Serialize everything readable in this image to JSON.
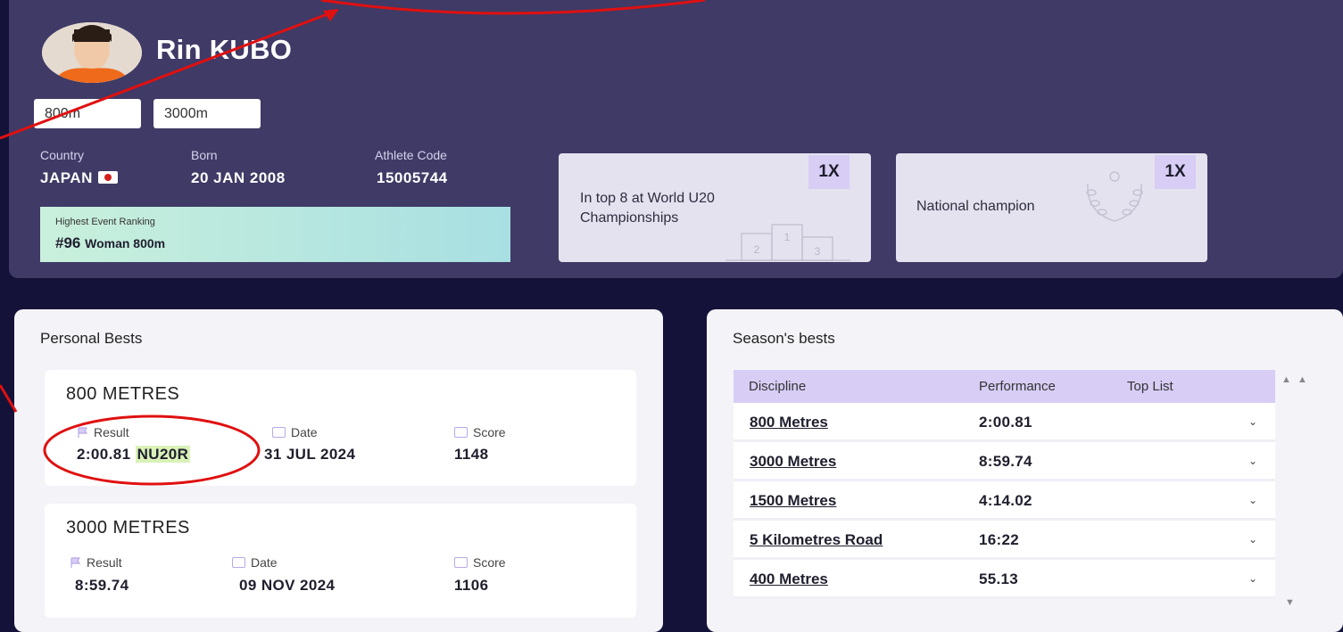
{
  "athlete": {
    "name": "Rin KUBO",
    "events": [
      "800m",
      "3000m"
    ],
    "country_label": "Country",
    "country_value": "JAPAN",
    "born_label": "Born",
    "born_value": "20 JAN 2008",
    "code_label": "Athlete Code",
    "code_value": "15005744"
  },
  "ranking": {
    "label": "Highest Event Ranking",
    "rank": "#96",
    "event": "Woman 800m"
  },
  "honours": [
    {
      "count": "1X",
      "text": "In top 8 at World U20 Championships",
      "icon": "podium-icon",
      "places": [
        "2",
        "1",
        "3"
      ]
    },
    {
      "count": "1X",
      "text": "National champion",
      "icon": "laurel-icon"
    }
  ],
  "personal_bests": {
    "title": "Personal Bests",
    "result_label": "Result",
    "date_label": "Date",
    "score_label": "Score",
    "items": [
      {
        "event": "800 METRES",
        "result": "2:00.81",
        "record": "NU20R",
        "date": "31 JUL 2024",
        "score": "1148"
      },
      {
        "event": "3000 METRES",
        "result": "8:59.74",
        "record": "",
        "date": "09 NOV 2024",
        "score": "1106"
      }
    ]
  },
  "season_bests": {
    "title": "Season's bests",
    "columns": [
      "Discipline",
      "Performance",
      "Top List"
    ],
    "rows": [
      {
        "discipline": "800 Metres",
        "performance": "2:00.81"
      },
      {
        "discipline": "3000 Metres",
        "performance": "8:59.74"
      },
      {
        "discipline": "1500 Metres",
        "performance": "4:14.02"
      },
      {
        "discipline": "5 Kilometres Road",
        "performance": "16:22"
      },
      {
        "discipline": "400 Metres",
        "performance": "55.13"
      }
    ],
    "chevron": "⌄",
    "scroll_up": "▲ ▲",
    "scroll_down": "▼"
  },
  "colors": {
    "header_bg": "#3f3a66",
    "page_bg": "#15123a",
    "annotation": "#e01010",
    "accent_purple": "#d7cdf5",
    "ranking_green": "#c9f0dc",
    "record_badge": "#d9f2b8"
  }
}
